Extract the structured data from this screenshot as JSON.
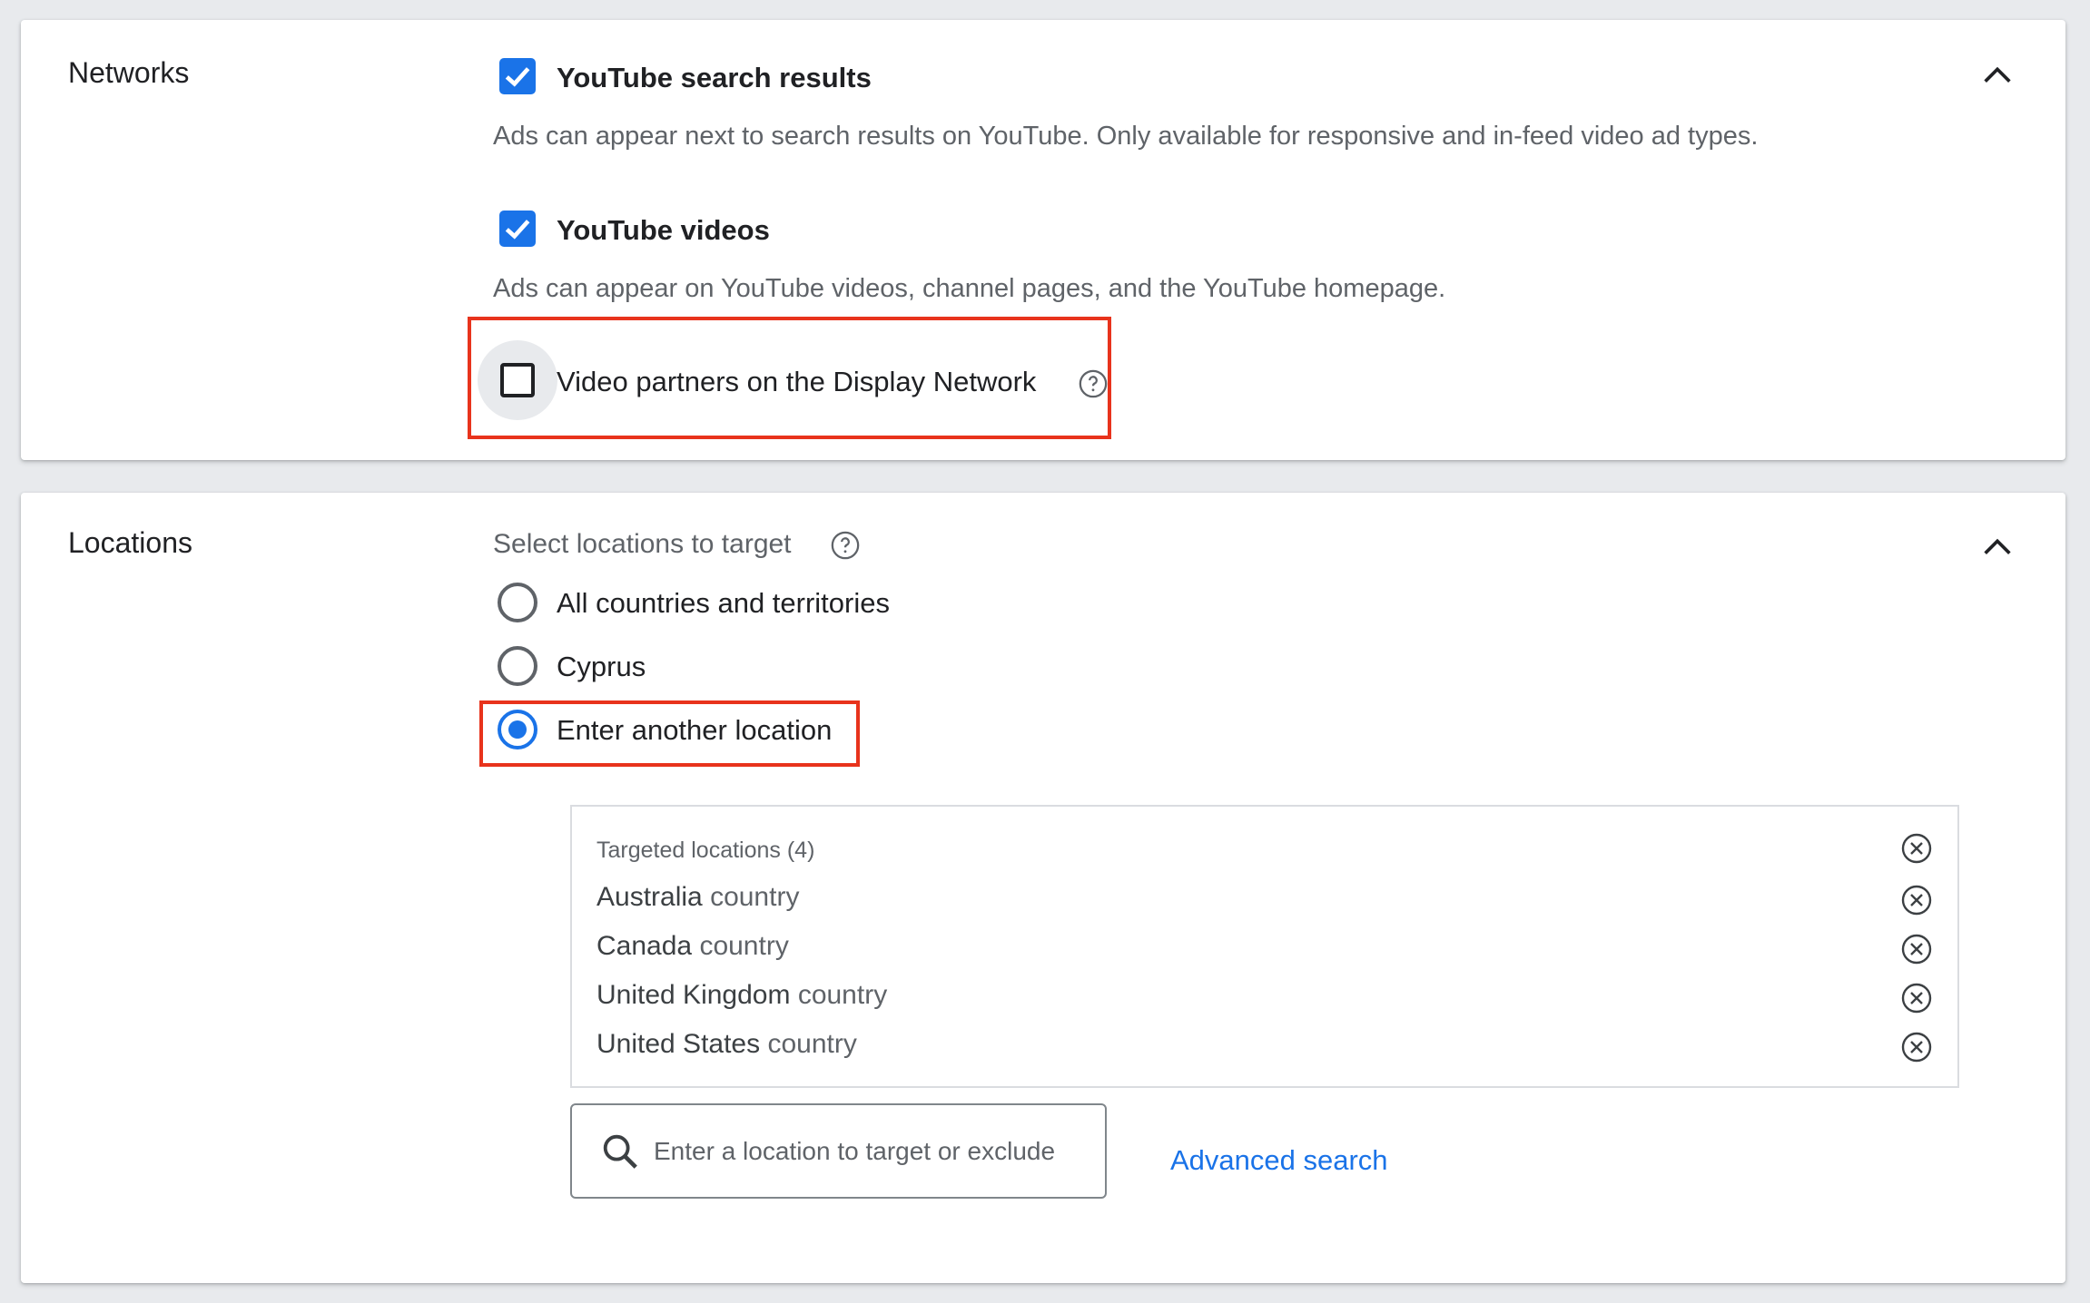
{
  "networks": {
    "title": "Networks",
    "options": [
      {
        "label": "YouTube search results",
        "checked": true,
        "description": "Ads can appear next to search results on YouTube. Only available for responsive and in-feed video ad types."
      },
      {
        "label": "YouTube videos",
        "checked": true,
        "description": "Ads can appear on YouTube videos, channel pages, and the YouTube homepage."
      },
      {
        "label": "Video partners on the Display Network",
        "checked": false
      }
    ]
  },
  "locations": {
    "title": "Locations",
    "prompt": "Select locations to target",
    "radio_options": [
      {
        "label": "All countries and territories",
        "selected": false
      },
      {
        "label": "Cyprus",
        "selected": false
      },
      {
        "label": "Enter another location",
        "selected": true
      }
    ],
    "targeted_header": "Targeted locations (4)",
    "targeted": [
      {
        "name": "Australia",
        "type": "country"
      },
      {
        "name": "Canada",
        "type": "country"
      },
      {
        "name": "United Kingdom",
        "type": "country"
      },
      {
        "name": "United States",
        "type": "country"
      }
    ],
    "search_placeholder": "Enter a location to target or exclude",
    "advanced_search": "Advanced search"
  },
  "colors": {
    "accent": "#1a73e8",
    "highlight_box": "#e8331c",
    "secondary_text": "#5f6368"
  }
}
